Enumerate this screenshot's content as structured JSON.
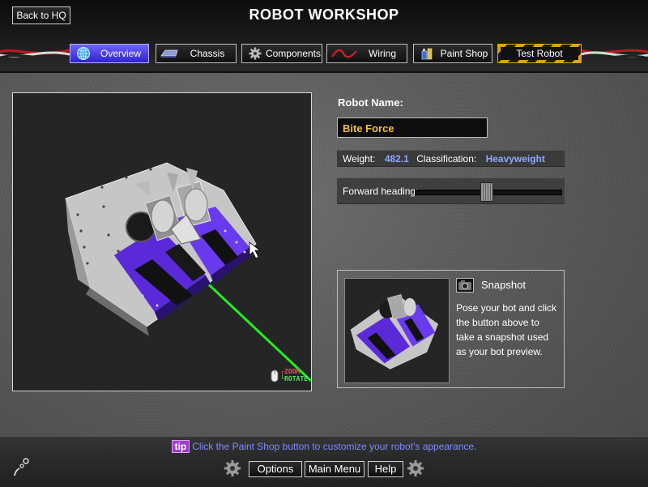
{
  "header": {
    "back_label": "Back to HQ",
    "title": "ROBOT WORKSHOP"
  },
  "tabs": [
    {
      "label": "Overview",
      "icon": "globe-icon",
      "active": true
    },
    {
      "label": "Chassis",
      "icon": "chassis-icon",
      "active": false
    },
    {
      "label": "Components",
      "icon": "gear-icon",
      "active": false
    },
    {
      "label": "Wiring",
      "icon": "wire-icon",
      "active": false
    },
    {
      "label": "Paint Shop",
      "icon": "paint-can-icon",
      "active": false
    },
    {
      "label": "Test Robot",
      "icon": "hazard-stripes",
      "active": false
    }
  ],
  "viewport": {
    "zoom_label": "ZOOM",
    "rotate_label": "ROTATE"
  },
  "robot": {
    "name_label": "Robot Name:",
    "name_value": "Bite Force",
    "weight_label": "Weight:",
    "weight_value": "482.1",
    "class_label": "Classification:",
    "class_value": "Heavyweight",
    "heading_label": "Forward heading:",
    "heading_fraction": 0.49
  },
  "snapshot": {
    "title": "Snapshot",
    "description": "Pose your bot and click the button above to take a snapshot used as your bot preview."
  },
  "footer": {
    "tip_tag": "tip",
    "tip_text": "Click the Paint Shop button to customize your robot's appearance.",
    "options_label": "Options",
    "main_menu_label": "Main Menu",
    "help_label": "Help"
  },
  "colors": {
    "accent": "#3d32e0",
    "value_text": "#8fa8ff",
    "robot_name": "#f0c040",
    "tip_text": "#7d8cff",
    "tip_tag": "#9c3cc8",
    "axis_line": "#22ee22",
    "hazard": "#e0a11a"
  }
}
